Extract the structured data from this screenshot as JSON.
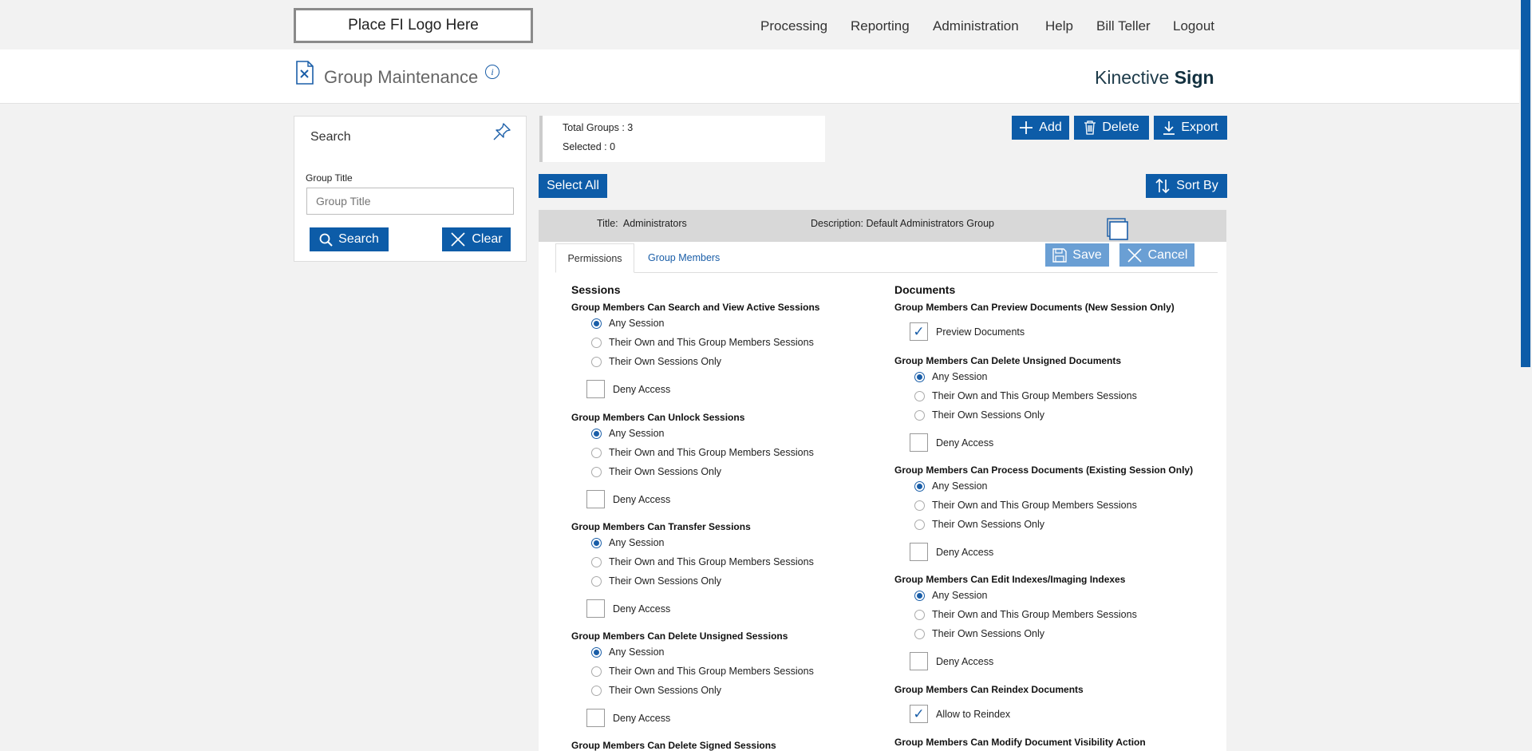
{
  "logo_text": "Place FI Logo Here",
  "nav": [
    "Processing",
    "Reporting",
    "Administration",
    "Help",
    "Bill Teller",
    "Logout"
  ],
  "page_title": "Group Maintenance",
  "brand": {
    "light": "Kinective ",
    "bold": "Sign"
  },
  "search": {
    "title": "Search",
    "field_label": "Group Title",
    "placeholder": "Group Title",
    "search_label": "Search",
    "clear_label": "Clear"
  },
  "totals": {
    "total_label": "Total Groups : ",
    "total_value": "3",
    "selected_label": "Selected : ",
    "selected_value": "0"
  },
  "toolbar": {
    "add": "Add",
    "delete": "Delete",
    "export": "Export",
    "select_all": "Select All",
    "sort_by": "Sort By"
  },
  "group": {
    "title_label": "Title:",
    "title_value": "Administrators",
    "desc_label": "Description:",
    "desc_value": "Default Administrators Group",
    "save": "Save",
    "cancel": "Cancel",
    "tabs": [
      "Permissions",
      "Group Members"
    ]
  },
  "options": [
    "Any Session",
    "Their Own and This Group Members Sessions",
    "Their Own Sessions Only"
  ],
  "deny_label": "Deny Access",
  "sessions": {
    "title": "Sessions",
    "questions": [
      "Group Members Can Search and View Active Sessions",
      "Group Members Can Unlock Sessions",
      "Group Members Can Transfer Sessions",
      "Group Members Can Delete Unsigned Sessions",
      "Group Members Can Delete Signed Sessions"
    ]
  },
  "documents": {
    "title": "Documents",
    "q_preview": "Group Members Can Preview Documents (New Session Only)",
    "preview_label": "Preview Documents",
    "q_delete": "Group Members Can Delete Unsigned Documents",
    "q_process": "Group Members Can Process Documents (Existing Session Only)",
    "q_edit": "Group Members Can Edit Indexes/Imaging Indexes",
    "q_reindex": "Group Members Can Reindex Documents",
    "reindex_label": "Allow to Reindex",
    "q_visibility": "Group Members Can Modify Document Visibility Action"
  },
  "colors": {
    "primary": "#0d5ca8",
    "disabled": "#6a9fd4"
  }
}
